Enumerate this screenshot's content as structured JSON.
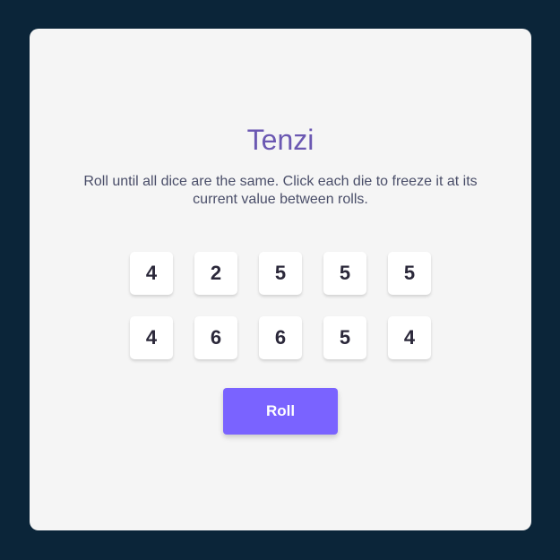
{
  "game": {
    "title": "Tenzi",
    "instructions": "Roll until all dice are the same. Click each die to freeze it at its current value between rolls.",
    "dice": [
      "4",
      "2",
      "5",
      "5",
      "5",
      "4",
      "6",
      "6",
      "5",
      "4"
    ],
    "roll_label": "Roll"
  },
  "colors": {
    "background": "#0b2539",
    "card": "#f5f5f5",
    "title": "#6b58b2",
    "accent": "#7a63ff",
    "die_face": "#ffffff",
    "die_text": "#2b283a"
  }
}
